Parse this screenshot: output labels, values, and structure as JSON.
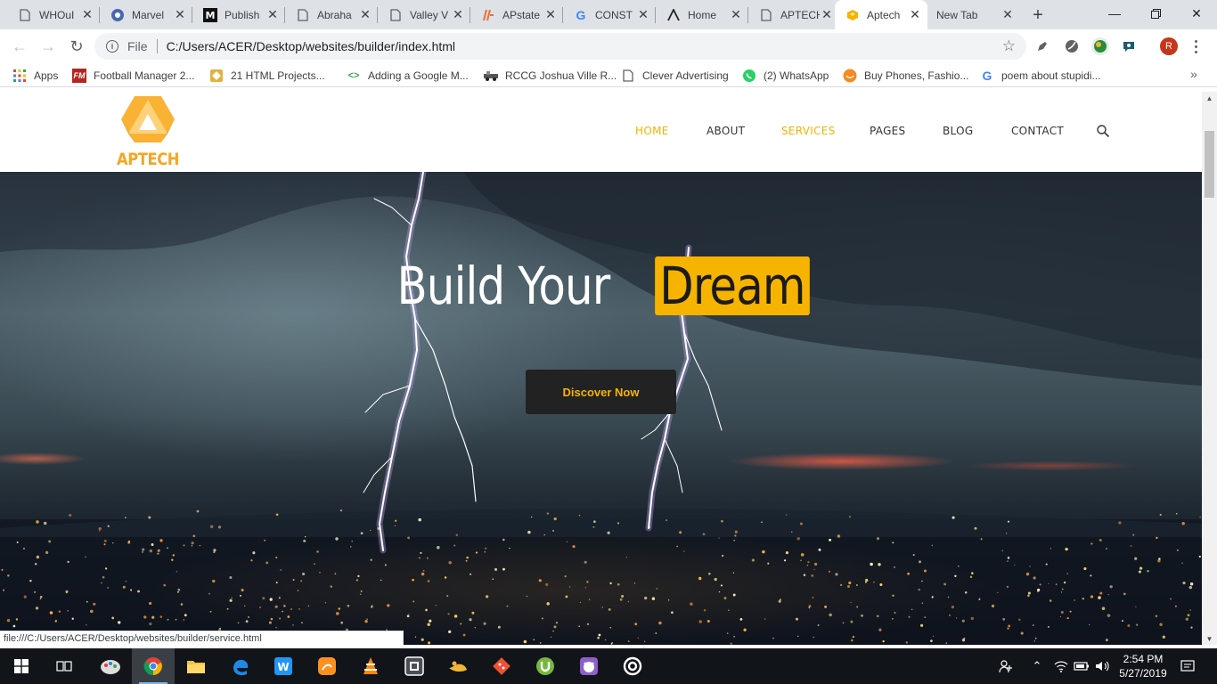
{
  "browser": {
    "tabs": [
      {
        "title": "WHOuI",
        "icon": "document-icon"
      },
      {
        "title": "Marvel",
        "icon": "marvel-icon"
      },
      {
        "title": "Publish",
        "icon": "medium-icon"
      },
      {
        "title": "Abraha",
        "icon": "document-icon"
      },
      {
        "title": "Valley V",
        "icon": "document-icon"
      },
      {
        "title": "APstate",
        "icon": "apstate-icon"
      },
      {
        "title": "CONST",
        "icon": "google-icon"
      },
      {
        "title": "Home",
        "icon": "lambda-icon"
      },
      {
        "title": "APTECH",
        "icon": "document-icon"
      },
      {
        "title": "Aptech",
        "icon": "aptech-icon",
        "active": true
      },
      {
        "title": "New Tab",
        "icon": "none"
      }
    ],
    "address": {
      "scheme_label": "File",
      "url": "C:/Users/ACER/Desktop/websites/builder/index.html"
    },
    "profile_initial": "R",
    "bookmarks": [
      {
        "label": "Apps",
        "icon": "apps-grid-icon"
      },
      {
        "label": "Football Manager 2...",
        "icon": "fm-icon"
      },
      {
        "label": "21 HTML Projects...",
        "icon": "html-projects-icon"
      },
      {
        "label": "Adding a Google M...",
        "icon": "code-icon"
      },
      {
        "label": "RCCG Joshua Ville R...",
        "icon": "rccg-icon"
      },
      {
        "label": "Clever Advertising",
        "icon": "document-icon"
      },
      {
        "label": "(2) WhatsApp",
        "icon": "whatsapp-icon"
      },
      {
        "label": "Buy Phones, Fashio...",
        "icon": "jumia-icon"
      },
      {
        "label": "poem about stupidi...",
        "icon": "google-icon"
      }
    ],
    "status_url": "file:///C:/Users/ACER/Desktop/websites/builder/service.html"
  },
  "site": {
    "logo_text": "APTECH BUILDER",
    "nav": [
      {
        "label": "HOME",
        "highlight": true
      },
      {
        "label": "ABOUT",
        "highlight": false
      },
      {
        "label": "SERVICES",
        "highlight": true
      },
      {
        "label": "PAGES",
        "highlight": false
      },
      {
        "label": "BLOG",
        "highlight": false
      },
      {
        "label": "CONTACT",
        "highlight": false
      }
    ],
    "hero": {
      "title_part1": "Build Your",
      "title_part2": "Dream",
      "button_label": "Discover Now"
    },
    "colors": {
      "accent": "#f6b400",
      "dark": "#222222"
    }
  },
  "taskbar": {
    "apps": [
      "start-icon",
      "task-view-icon",
      "paint-icon",
      "chrome-icon",
      "file-explorer-icon",
      "edge-icon",
      "wps-icon",
      "uc-browser-icon",
      "vlc-icon",
      "sublime-icon",
      "genie-icon",
      "git-icon",
      "utorrent-icon",
      "github-desktop-icon",
      "ring-app-icon"
    ],
    "time": "2:54 PM",
    "date": "5/27/2019"
  }
}
